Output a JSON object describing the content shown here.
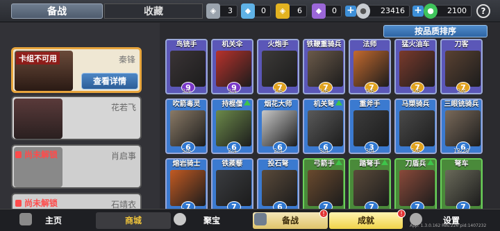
{
  "tabs": {
    "beizhan": "备战",
    "shoucang": "收藏"
  },
  "currencies": [
    {
      "icon": "silver-medal-icon",
      "value": "3",
      "color": "#9aa3ad"
    },
    {
      "icon": "blue-crystal-icon",
      "value": "0",
      "color": "#5fb2e6"
    },
    {
      "icon": "gold-medal-icon",
      "value": "6",
      "color": "#e3b321"
    },
    {
      "icon": "purple-crystal-icon",
      "value": "0",
      "color": "#9b67d8"
    },
    {
      "icon": "silver-coin-icon",
      "value": "23416",
      "color": "#c9cdd2"
    },
    {
      "icon": "green-jade-icon",
      "value": "2100",
      "color": "#3fc45b"
    }
  ],
  "help": "?",
  "sort_label": "按品质排序",
  "generals": {
    "selected": {
      "warning": "卡组不可用",
      "name": "秦锋",
      "detail": "查看详情"
    },
    "second": {
      "name": "花若飞"
    },
    "locked1": {
      "status": "尚未解锁",
      "name": "肖启事"
    },
    "locked2": {
      "status": "尚未解锁",
      "name": "石靖衣"
    }
  },
  "units": [
    {
      "name": "鸟铳手",
      "level": "9",
      "count": "3/4",
      "frame": "#5b57b8",
      "lvlcolor": "#7a38c8",
      "art": "#3a3436",
      "arrow": false
    },
    {
      "name": "机关伞",
      "level": "9",
      "count": "3/4",
      "frame": "#5b57b8",
      "lvlcolor": "#7a38c8",
      "art": "#b8322c",
      "arrow": false
    },
    {
      "name": "火炮手",
      "level": "7",
      "count": "1/6",
      "frame": "#5b57b8",
      "lvlcolor": "#e0a21f",
      "art": "#3c3a38",
      "arrow": false
    },
    {
      "name": "铁鞭重骑兵",
      "level": "7",
      "count": "1/6",
      "frame": "#5b57b8",
      "lvlcolor": "#e0a21f",
      "art": "#6b5a4a",
      "arrow": false
    },
    {
      "name": "法师",
      "level": "7",
      "count": "0/6",
      "frame": "#5b57b8",
      "lvlcolor": "#e0a21f",
      "art": "#c46a2e",
      "arrow": false
    },
    {
      "name": "猛火油车",
      "level": "7",
      "count": "1/6",
      "frame": "#5b57b8",
      "lvlcolor": "#e0a21f",
      "art": "#7a3a2c",
      "arrow": false
    },
    {
      "name": "刀客",
      "level": "7",
      "count": "3/4",
      "frame": "#5b57b8",
      "lvlcolor": "#e0a21f",
      "art": "#5a4232",
      "arrow": false
    },
    {
      "name": "吹箭毒灵",
      "level": "6",
      "count": "5/6",
      "frame": "#3b7ad0",
      "lvlcolor": "#2f77d0",
      "art": "#8a7a66",
      "arrow": false
    },
    {
      "name": "持棍僧",
      "level": "6",
      "count": "2/4",
      "frame": "#3b7ad0",
      "lvlcolor": "#2f77d0",
      "art": "#6c8a4a",
      "arrow": true
    },
    {
      "name": "烟花大师",
      "level": "6",
      "count": "2/4",
      "frame": "#3b7ad0",
      "lvlcolor": "#2f77d0",
      "art": "#c8c8c8",
      "arrow": false
    },
    {
      "name": "机关弩",
      "level": "6",
      "count": "3/4",
      "frame": "#3b7ad0",
      "lvlcolor": "#2f77d0",
      "art": "#5a5a5a",
      "arrow": true
    },
    {
      "name": "重斧手",
      "level": "3",
      "count": "3/4",
      "frame": "#3b7ad0",
      "lvlcolor": "#2f77d0",
      "art": "#3c3c3c",
      "arrow": false
    },
    {
      "name": "马槊骑兵",
      "level": "7",
      "count": "1/6",
      "frame": "#3b7ad0",
      "lvlcolor": "#e0a21f",
      "art": "#4a4a4a",
      "arrow": false
    },
    {
      "name": "三眼铳骑兵",
      "level": "6",
      "count": "12/20",
      "frame": "#3b7ad0",
      "lvlcolor": "#2f77d0",
      "art": "#7a6a5a",
      "arrow": false
    },
    {
      "name": "熔岩骑士",
      "level": "7",
      "count": "1/6",
      "frame": "#3b7ad0",
      "lvlcolor": "#2f77d0",
      "art": "#c25a22",
      "arrow": false
    },
    {
      "name": "铁蒺藜",
      "level": "7",
      "count": "",
      "frame": "#3b7ad0",
      "lvlcolor": "#2f77d0",
      "art": "#3a3c40",
      "arrow": false
    },
    {
      "name": "投石弩",
      "level": "6",
      "count": "",
      "frame": "#3b7ad0",
      "lvlcolor": "#2f77d0",
      "art": "#5a4a3a",
      "arrow": false
    },
    {
      "name": "弓箭手",
      "level": "7",
      "count": "",
      "frame": "#4a8a3a",
      "lvlcolor": "#2f77d0",
      "art": "#6a4a2e",
      "arrow": true
    },
    {
      "name": "踏弩手",
      "level": "7",
      "count": "",
      "frame": "#4a8a3a",
      "lvlcolor": "#2f77d0",
      "art": "#5a4a3a",
      "arrow": true
    },
    {
      "name": "刀盾兵",
      "level": "7",
      "count": "",
      "frame": "#4a8a3a",
      "lvlcolor": "#2f77d0",
      "art": "#8a4a3a",
      "arrow": true
    },
    {
      "name": "弩车",
      "level": "7",
      "count": "",
      "frame": "#4a8a3a",
      "lvlcolor": "#2f77d0",
      "art": "#6a6a5a",
      "arrow": false
    }
  ],
  "bottom": {
    "home": "主页",
    "shop": "商城",
    "treasure": "聚宝",
    "prepare": "备战",
    "achieve": "成就",
    "settings": "设置",
    "badge1": "!",
    "badge2": "!"
  },
  "version": "App: 1.3.0.162 Res:226 pid:1407232"
}
